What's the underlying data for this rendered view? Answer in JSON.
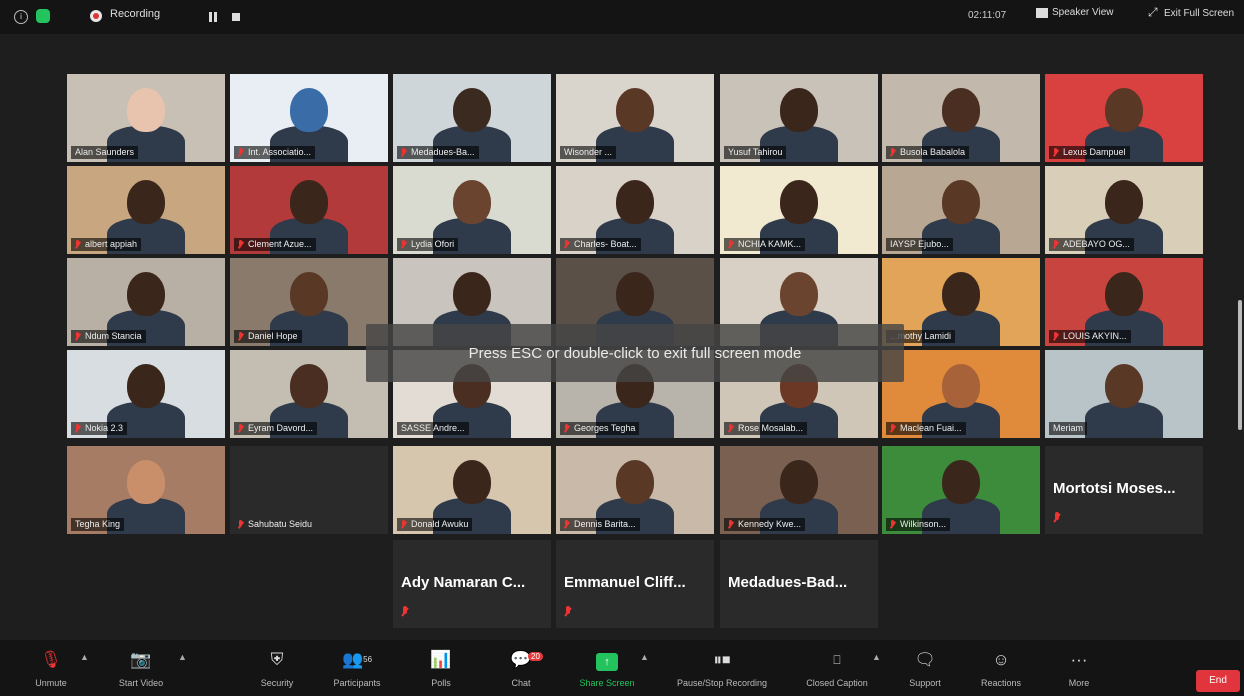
{
  "topbar": {
    "recording_label": "Recording",
    "timer": "02:11:07",
    "speaker_view": "Speaker View",
    "exit_full_screen": "Exit Full Screen"
  },
  "toast": "Press ESC or double-click to exit full screen mode",
  "participants": [
    {
      "name": "Alan Saunders",
      "video": true,
      "muted": false,
      "bg": "#c8c0b4",
      "skin": "#e8c4ae"
    },
    {
      "name": "Int. Associatio...",
      "video": true,
      "muted": true,
      "bg": "#e8eef3",
      "skin": "#3a6da8"
    },
    {
      "name": "Medadues-Ba...",
      "video": true,
      "muted": true,
      "bg": "#cfd6d9",
      "skin": "#3b2a20"
    },
    {
      "name": "Wisonder ...",
      "video": true,
      "muted": false,
      "bg": "#d9d4cc",
      "skin": "#5a3826"
    },
    {
      "name": "Yusuf Tahirou",
      "video": true,
      "muted": false,
      "bg": "#c9c2b8",
      "skin": "#3b261b"
    },
    {
      "name": "Busola Babalola",
      "video": true,
      "muted": true,
      "bg": "#c2b8ab",
      "skin": "#4a2e22"
    },
    {
      "name": "Lexus Dampuel",
      "video": true,
      "muted": true,
      "bg": "#d94040",
      "skin": "#5a3826"
    },
    {
      "name": "albert appiah",
      "video": true,
      "muted": true,
      "bg": "#c8a680",
      "skin": "#3b261b"
    },
    {
      "name": "Clement Azue...",
      "video": true,
      "muted": true,
      "bg": "#b23a3a",
      "skin": "#3b261b"
    },
    {
      "name": "Lydia Ofori",
      "video": true,
      "muted": true,
      "bg": "#d9dbd0",
      "skin": "#6b4430"
    },
    {
      "name": "Charles- Boat...",
      "video": true,
      "muted": true,
      "bg": "#d9d2c8",
      "skin": "#3b261b"
    },
    {
      "name": "NCHIA KAMK...",
      "video": true,
      "muted": true,
      "bg": "#f1e9d0",
      "skin": "#3b261b"
    },
    {
      "name": "IAYSP Ejubo...",
      "video": true,
      "muted": false,
      "bg": "#b8a792",
      "skin": "#5a3826"
    },
    {
      "name": "ADEBAYO OG...",
      "video": true,
      "muted": true,
      "bg": "#d9cfb8",
      "skin": "#3b261b"
    },
    {
      "name": "Ndum Stancia",
      "video": true,
      "muted": true,
      "bg": "#b9b0a5",
      "skin": "#3b261b"
    },
    {
      "name": "Daniel Hope",
      "video": true,
      "muted": true,
      "bg": "#8a7a6b",
      "skin": "#5a3826"
    },
    {
      "name": "",
      "video": true,
      "muted": false,
      "bg": "#c9c4bd",
      "skin": "#3b261b"
    },
    {
      "name": "",
      "video": true,
      "muted": false,
      "bg": "#5a5048",
      "skin": "#3b261b"
    },
    {
      "name": "",
      "video": true,
      "muted": false,
      "bg": "#d8d0c4",
      "skin": "#6b4430"
    },
    {
      "name": "...mothy Lamidi",
      "video": true,
      "muted": false,
      "bg": "#e2a458",
      "skin": "#3b261b"
    },
    {
      "name": "LOUIS AKYIN...",
      "video": true,
      "muted": true,
      "bg": "#c8443e",
      "skin": "#3b261b"
    },
    {
      "name": "Nokia 2.3",
      "video": true,
      "muted": true,
      "bg": "#d8dde2",
      "skin": "#3b261b"
    },
    {
      "name": "Eyram Davord...",
      "video": true,
      "muted": true,
      "bg": "#c4bdb2",
      "skin": "#4a2e22"
    },
    {
      "name": "SASSE Andre...",
      "video": true,
      "muted": false,
      "bg": "#e2dcd4",
      "skin": "#4a2e22"
    },
    {
      "name": "Georges Tegha",
      "video": true,
      "muted": true,
      "bg": "#b8b3ab",
      "skin": "#3b261b"
    },
    {
      "name": "Rose Mosalab...",
      "video": true,
      "muted": true,
      "bg": "#cfc6b8",
      "skin": "#6b3826"
    },
    {
      "name": "Maclean Fuai...",
      "video": true,
      "muted": true,
      "bg": "#e08a3c",
      "skin": "#a8623a"
    },
    {
      "name": "Meriam",
      "video": true,
      "muted": false,
      "bg": "#b9c4c9",
      "skin": "#5a3826"
    },
    {
      "name": "Tegha King",
      "video": true,
      "muted": false,
      "bg": "#a67d64",
      "skin": "#c98f6b"
    },
    {
      "name": "Sahubatu Seidu",
      "video": false,
      "muted": true
    },
    {
      "name": "Donald Awuku",
      "video": true,
      "muted": true,
      "bg": "#d6c6ae",
      "skin": "#3b261b"
    },
    {
      "name": "Dennis Barita...",
      "video": true,
      "muted": true,
      "bg": "#c9b9a9",
      "skin": "#5a3826"
    },
    {
      "name": "Kennedy Kwe...",
      "video": true,
      "muted": true,
      "bg": "#7a6050",
      "skin": "#3b261b"
    },
    {
      "name": "Wilkinson...",
      "video": true,
      "muted": true,
      "bg": "#3c8c3c",
      "skin": "#3b261b"
    },
    {
      "name": "Mortotsi Moses...",
      "video": false,
      "muted": true,
      "big": true
    },
    {
      "name": "Ady Namaran C...",
      "video": false,
      "muted": true,
      "big": true
    },
    {
      "name": "Emmanuel Cliff...",
      "video": false,
      "muted": true,
      "big": true
    },
    {
      "name": "Medadues-Bad...",
      "video": false,
      "muted": false,
      "big": true
    }
  ],
  "toolbar": {
    "unmute": "Unmute",
    "start_video": "Start Video",
    "security": "Security",
    "participants": "Participants",
    "participants_count": "56",
    "polls": "Polls",
    "chat": "Chat",
    "chat_badge": "20",
    "share_screen": "Share Screen",
    "pause_stop_recording": "Pause/Stop Recording",
    "closed_caption": "Closed Caption",
    "support": "Support",
    "reactions": "Reactions",
    "more": "More",
    "end": "End"
  }
}
